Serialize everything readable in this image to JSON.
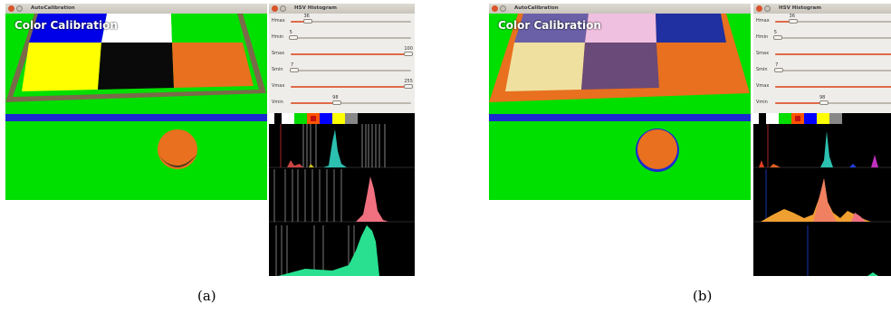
{
  "panel_a": {
    "main_window": {
      "title": "AutoCalibration",
      "overlay": "Color Calibration"
    },
    "hist_window": {
      "title": "HSV Histogram"
    },
    "sliders": [
      {
        "label": "Hmax",
        "value": "36",
        "fraction": 0.14
      },
      {
        "label": "Hmin",
        "value": "5",
        "fraction": 0.02
      },
      {
        "label": "Smax",
        "value": "100",
        "fraction": 0.98
      },
      {
        "label": "Smin",
        "value": "7",
        "fraction": 0.03
      },
      {
        "label": "Vmax",
        "value": "255",
        "fraction": 0.98
      },
      {
        "label": "Vmin",
        "value": "98",
        "fraction": 0.38
      }
    ],
    "caption": "(a)"
  },
  "panel_b": {
    "main_window": {
      "title": "AutoCalibration",
      "overlay": "Color Calibration"
    },
    "hist_window": {
      "title": "HSV Histogram"
    },
    "sliders": [
      {
        "label": "Hmax",
        "value": "36",
        "fraction": 0.14
      },
      {
        "label": "Hmin",
        "value": "5",
        "fraction": 0.02
      },
      {
        "label": "Smax",
        "value": "",
        "fraction": 0.98
      },
      {
        "label": "Smin",
        "value": "7",
        "fraction": 0.03
      },
      {
        "label": "Vmax",
        "value": "",
        "fraction": 0.98
      },
      {
        "label": "Vmin",
        "value": "98",
        "fraction": 0.38
      }
    ],
    "caption": "(b)"
  },
  "swatch_colors": [
    "#ffffff",
    "#00dd00",
    "#ff5500",
    "#0000ff",
    "#ffff00",
    "#888888"
  ],
  "colors": {
    "field_green": "#00e000",
    "ball_orange": "#e8701e",
    "slider_fill": "#e06a47"
  }
}
